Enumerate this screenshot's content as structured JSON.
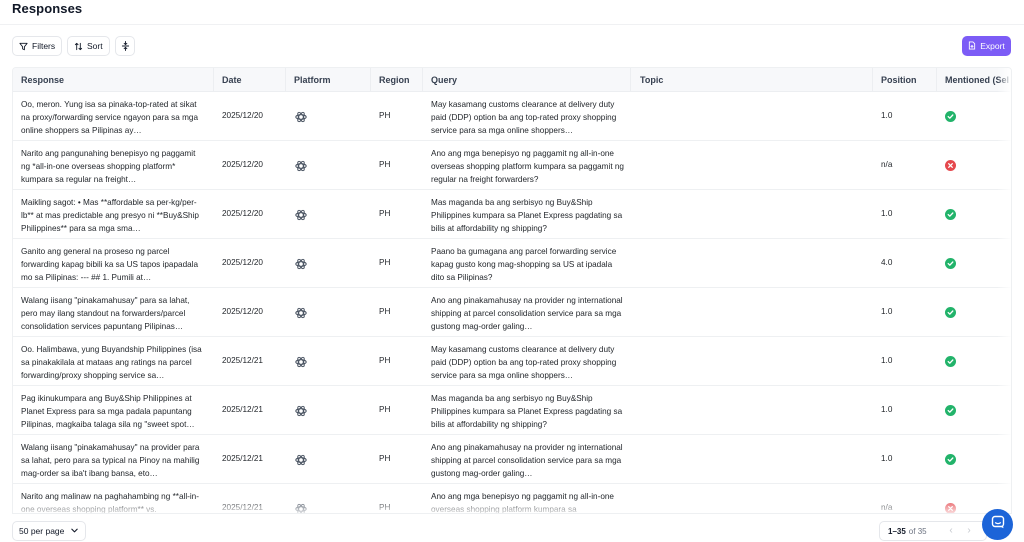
{
  "page": {
    "title": "Responses"
  },
  "toolbar": {
    "filters_label": "Filters",
    "sort_label": "Sort",
    "export_label": "Export"
  },
  "columns": {
    "response": "Response",
    "date": "Date",
    "platform": "Platform",
    "region": "Region",
    "query": "Query",
    "topic": "Topic",
    "position": "Position",
    "mentioned": "Mentioned (Sel"
  },
  "rows": [
    {
      "response": "Oo, meron. Yung isa sa pinaka-top-rated at sikat na proxy/forwarding service ngayon para sa mga online shoppers sa Pilipinas ay…",
      "date": "2025/12/20",
      "platform_icon": "openai-icon",
      "region": "PH",
      "query": "May kasamang customs clearance at delivery duty paid (DDP) option ba ang top-rated proxy shopping service para sa mga online shoppers…",
      "topic": "",
      "position": "1.0",
      "mentioned": true
    },
    {
      "response": "Narito ang pangunahing benepisyo ng paggamit ng *all-in-one overseas shopping platform* kumpara sa regular na freight…",
      "date": "2025/12/20",
      "platform_icon": "openai-icon",
      "region": "PH",
      "query": "Ano ang mga benepisyo ng paggamit ng all-in-one overseas shopping platform kumpara sa paggamit ng regular na freight forwarders?",
      "topic": "",
      "position": "n/a",
      "mentioned": false
    },
    {
      "response": "Maikling sagot: • Mas **affordable sa per-kg/per-lb** at mas predictable ang presyo ni **Buy&Ship Philippines** para sa mga sma…",
      "date": "2025/12/20",
      "platform_icon": "openai-icon",
      "region": "PH",
      "query": "Mas maganda ba ang serbisyo ng Buy&Ship Philippines kumpara sa Planet Express pagdating sa bilis at affordability ng shipping?",
      "topic": "",
      "position": "1.0",
      "mentioned": true
    },
    {
      "response": "Ganito ang general na proseso ng parcel forwarding kapag bibili ka sa US tapos ipapadala mo sa Pilipinas: --- ## 1. Pumili at…",
      "date": "2025/12/20",
      "platform_icon": "openai-icon",
      "region": "PH",
      "query": "Paano ba gumagana ang parcel forwarding service kapag gusto kong mag-shopping sa US at ipadala dito sa Pilipinas?",
      "topic": "",
      "position": "4.0",
      "mentioned": true
    },
    {
      "response": "Walang iisang \"pinakamahusay\" para sa lahat, pero may ilang standout na forwarders/parcel consolidation services papuntang Pilipinas…",
      "date": "2025/12/20",
      "platform_icon": "openai-icon",
      "region": "PH",
      "query": "Ano ang pinakamahusay na provider ng international shipping at parcel consolidation service para sa mga gustong mag-order galing…",
      "topic": "",
      "position": "1.0",
      "mentioned": true
    },
    {
      "response": "Oo. Halimbawa, yung Buyandship Philippines (isa sa pinakakilala at mataas ang ratings na parcel forwarding/proxy shopping service sa…",
      "date": "2025/12/21",
      "platform_icon": "openai-icon",
      "region": "PH",
      "query": "May kasamang customs clearance at delivery duty paid (DDP) option ba ang top-rated proxy shopping service para sa mga online shoppers…",
      "topic": "",
      "position": "1.0",
      "mentioned": true
    },
    {
      "response": "Pag ikinukumpara ang Buy&Ship Philippines at Planet Express para sa mga padala papuntang Pilipinas, magkaiba talaga sila ng \"sweet spot…",
      "date": "2025/12/21",
      "platform_icon": "openai-icon",
      "region": "PH",
      "query": "Mas maganda ba ang serbisyo ng Buy&Ship Philippines kumpara sa Planet Express pagdating sa bilis at affordability ng shipping?",
      "topic": "",
      "position": "1.0",
      "mentioned": true
    },
    {
      "response": "Walang iisang \"pinakamahusay\" na provider para sa lahat, pero para sa typical na Pinoy na mahilig mag-order sa iba't ibang bansa, eto…",
      "date": "2025/12/21",
      "platform_icon": "openai-icon",
      "region": "PH",
      "query": "Ano ang pinakamahusay na provider ng international shipping at parcel consolidation service para sa mga gustong mag-order galing…",
      "topic": "",
      "position": "1.0",
      "mentioned": true
    },
    {
      "response": "Narito ang malinaw na paghahambing ng **all-in-one overseas shopping platform** vs.",
      "date": "2025/12/21",
      "platform_icon": "openai-icon",
      "region": "PH",
      "query": "Ano ang mga benepisyo ng paggamit ng all-in-one overseas shopping platform kumpara sa",
      "topic": "",
      "position": "n/a",
      "mentioned": false
    }
  ],
  "footer": {
    "per_page": "50 per page",
    "range": "1–35",
    "of_total": "of 35"
  }
}
